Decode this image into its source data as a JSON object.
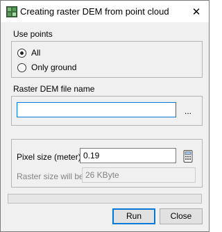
{
  "window": {
    "title": "Creating raster DEM from point cloud"
  },
  "use_points": {
    "label": "Use points",
    "options": [
      {
        "label": "All",
        "selected": true
      },
      {
        "label": "Only ground",
        "selected": false
      }
    ]
  },
  "raster_file": {
    "label": "Raster DEM file name",
    "value": "",
    "browse_label": "..."
  },
  "pixel": {
    "size_label": "Pixel size (meter)",
    "size_value": "0.19",
    "raster_size_label": "Raster size will be",
    "raster_size_value": "26 KByte"
  },
  "progress": {
    "value": 0
  },
  "buttons": {
    "run": "Run",
    "close": "Close"
  },
  "icons": {
    "app": "dem-app-icon",
    "close": "close-icon",
    "calculator": "calculator-icon"
  },
  "colors": {
    "accent": "#0078d7",
    "progress_fill": "#06b025"
  }
}
